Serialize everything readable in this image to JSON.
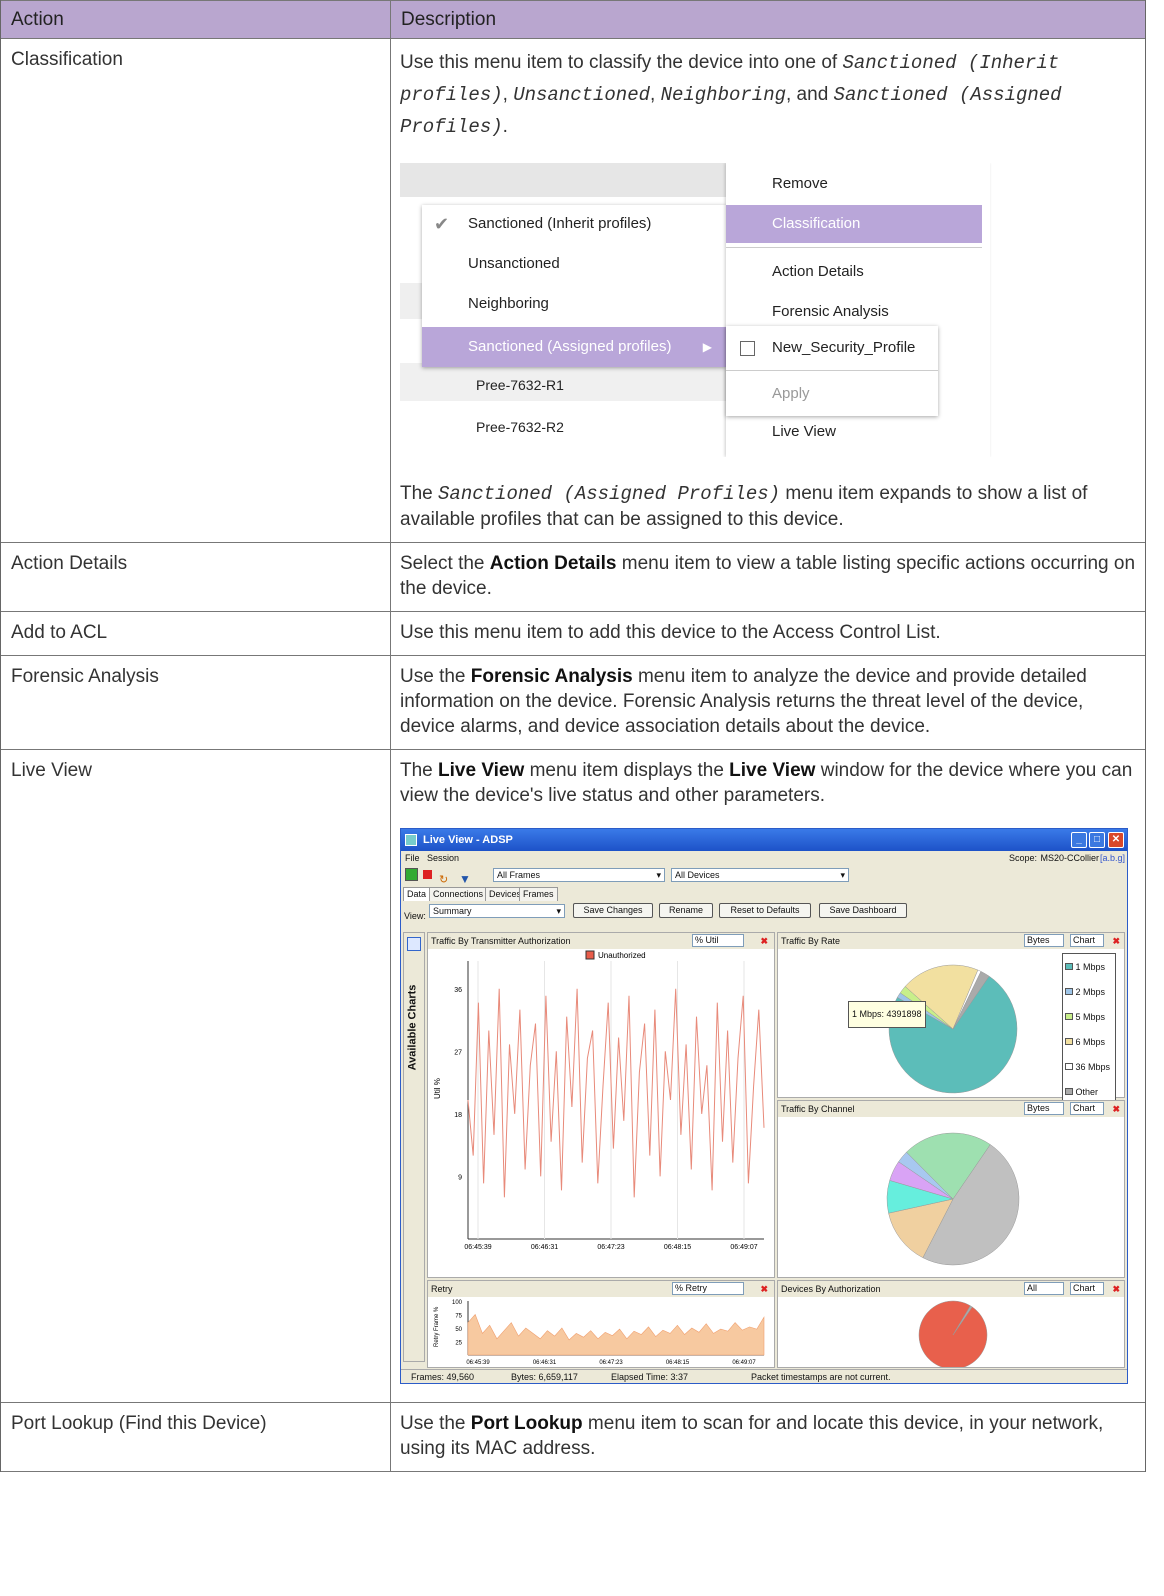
{
  "header": {
    "action": "Action",
    "description": "Description"
  },
  "rows": {
    "classification": {
      "action": "Classification",
      "d1": "Use this menu item to classify the device into one of ",
      "c1": "Sanctioned (Inherit profiles)",
      "d2": ", ",
      "c2": "Unsanctioned",
      "d3": ", ",
      "c3": "Neighboring",
      "d4": ", and ",
      "c4": "Sanctioned (Assigned Profiles)",
      "d5": ".",
      "after1": "The ",
      "after_code": "Sanctioned (Assigned Profiles)",
      "after2": " menu item expands to show a list of available profiles that can be assigned to this device."
    },
    "action_details": {
      "action": "Action Details",
      "d1": "Select the ",
      "bold": "Action Details",
      "d2": " menu item to view a table listing specific actions occurring on the device."
    },
    "add_acl": {
      "action": "Add to ACL",
      "d1": "Use this menu item to add this device to the Access Control List."
    },
    "forensic": {
      "action": "Forensic Analysis",
      "d1": "Use the ",
      "bold": "Forensic Analysis",
      "d2": " menu item to analyze the device and provide detailed information on the device. Forensic Analysis returns the threat level of the device, device alarms, and device association details about the device."
    },
    "live_view": {
      "action": "Live View",
      "d1": "The ",
      "bold1": "Live View",
      "d2": " menu item displays the ",
      "bold2": "Live View",
      "d3": " window for the device where you can view the device's live status and other parameters."
    },
    "port_lookup": {
      "action": "Port Lookup (Find this Device)",
      "d1": "Use the ",
      "bold": "Port Lookup",
      "d2": " menu item to scan for and locate this device, in your network, using its MAC address."
    }
  },
  "menu_shot": {
    "left_menu": [
      "Sanctioned (Inherit profiles)",
      "Unsanctioned",
      "Neighboring",
      "Sanctioned (Assigned profiles)"
    ],
    "rows": [
      "Pree-7632-R1",
      "Pree-7632-R2"
    ],
    "right_menu": [
      "Remove",
      "Classification",
      "Action Details",
      "Forensic Analysis",
      "Live View"
    ],
    "submenu": {
      "profile": "New_Security_Profile",
      "apply": "Apply"
    }
  },
  "live_shot": {
    "title": "Live View - ADSP",
    "menus": [
      "File",
      "Session"
    ],
    "scope_label": "Scope:",
    "scope_value": "MS20-CCollier",
    "scope_tag": "[a.b.g]",
    "frames_select": "All Frames",
    "devices_select": "All Devices",
    "tabs": [
      "Data",
      "Connections",
      "Devices",
      "Frames"
    ],
    "view_label": "View:",
    "view_value": "Summary",
    "buttons": [
      "Save Changes",
      "Rename",
      "Reset to Defaults",
      "Save Dashboard"
    ],
    "available_charts": "Available Charts",
    "panes": {
      "tx_auth": {
        "title": "Traffic By Transmitter Authorization",
        "unit": "% Util",
        "legend": "Unauthorized",
        "ylabel": "Util %",
        "yticks": [
          "36",
          "27",
          "18",
          "9"
        ],
        "xticks": [
          "06:45:39",
          "06:46:31",
          "06:47:23",
          "06:48:15",
          "06:49:07"
        ]
      },
      "rate": {
        "title": "Traffic By Rate",
        "unit": "Bytes",
        "mode": "Chart",
        "legend": [
          "1 Mbps",
          "2 Mbps",
          "5 Mbps",
          "6 Mbps",
          "36 Mbps",
          "Other"
        ],
        "tooltip": "1 Mbps: 4391898"
      },
      "channel": {
        "title": "Traffic By Channel",
        "unit": "Bytes",
        "mode": "Chart"
      },
      "retry": {
        "title": "Retry",
        "unit": "% Retry",
        "ylabel": "Retry Frame %",
        "yticks": [
          "100",
          "75",
          "50",
          "25"
        ],
        "xticks": [
          "06:45:39",
          "06:46:31",
          "06:47:23",
          "06:48:15",
          "06:49:07"
        ]
      },
      "devauth": {
        "title": "Devices By Authorization",
        "unit": "All",
        "mode": "Chart"
      }
    },
    "status": {
      "frames": "Frames: 49,560",
      "bytes": "Bytes: 6,659,117",
      "elapsed": "Elapsed Time: 3:37",
      "note": "Packet timestamps are not current."
    }
  },
  "chart_data": [
    {
      "type": "line",
      "title": "Traffic By Transmitter Authorization",
      "ylabel": "Util %",
      "ylim": [
        0,
        40
      ],
      "series": [
        {
          "name": "Unauthorized",
          "values": [
            20,
            12,
            34,
            8,
            30,
            15,
            36,
            6,
            28,
            18,
            33,
            10,
            25,
            31,
            9,
            35,
            14,
            27,
            7,
            32,
            19,
            36,
            11,
            26,
            30,
            8,
            22,
            34,
            13,
            29,
            17,
            35,
            6,
            24,
            31,
            12,
            33,
            9,
            27,
            20,
            36,
            15,
            28,
            10,
            32,
            18,
            25,
            7,
            34,
            14,
            30,
            11,
            26,
            35,
            8,
            22,
            33,
            16
          ]
        }
      ]
    },
    {
      "type": "pie",
      "title": "Traffic By Rate",
      "categories": [
        "1 Mbps",
        "2 Mbps",
        "5 Mbps",
        "6 Mbps",
        "36 Mbps",
        "Other"
      ],
      "values": [
        4391898,
        80000,
        120000,
        1180000,
        50000,
        140000
      ]
    },
    {
      "type": "pie",
      "title": "Traffic By Channel",
      "values": [
        48,
        14,
        8,
        5,
        3,
        22
      ]
    },
    {
      "type": "area",
      "title": "Retry",
      "ylabel": "Retry Frame %",
      "ylim": [
        0,
        100
      ],
      "values": [
        60,
        75,
        40,
        55,
        30,
        45,
        60,
        35,
        50,
        40,
        30,
        45,
        35,
        50,
        28,
        40,
        33,
        45,
        30,
        42,
        36,
        48,
        30,
        44,
        38,
        52,
        34,
        46,
        40,
        55,
        38,
        50,
        42,
        58,
        40,
        48,
        44,
        60,
        46,
        52,
        48,
        70
      ]
    },
    {
      "type": "pie",
      "title": "Devices By Authorization",
      "values": [
        99,
        1
      ]
    }
  ]
}
